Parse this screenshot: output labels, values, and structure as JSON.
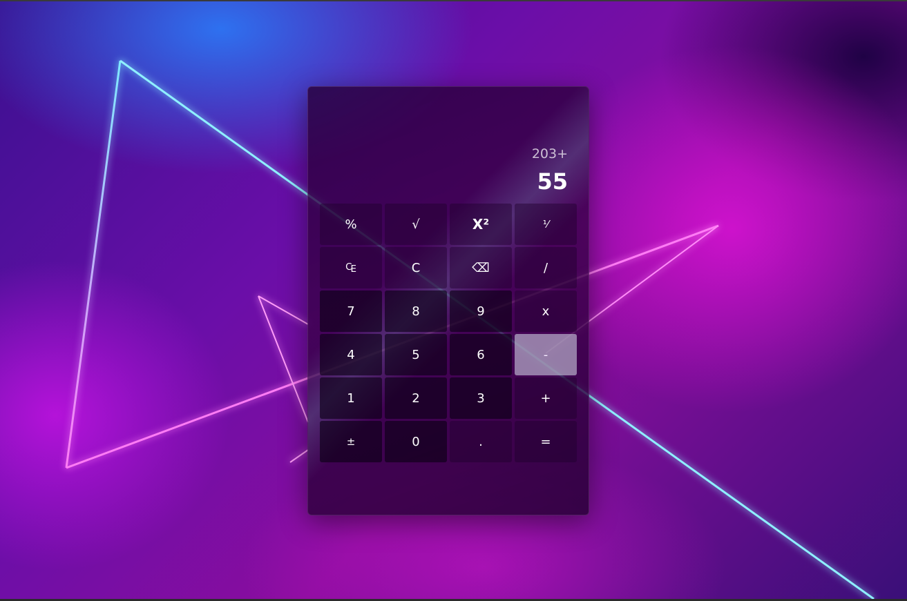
{
  "display": {
    "expression": "203+",
    "result": "55"
  },
  "keys": [
    {
      "label": "%",
      "name": "percent-button"
    },
    {
      "label": "√",
      "name": "square-root-button"
    },
    {
      "label": "X²",
      "name": "square-button"
    },
    {
      "label": "¹⁄",
      "name": "reciprocal-button"
    },
    {
      "label": "₠",
      "name": "clear-entry-button"
    },
    {
      "label": "C",
      "name": "clear-button"
    },
    {
      "label": "⌫",
      "name": "backspace-button"
    },
    {
      "label": "/",
      "name": "divide-button"
    },
    {
      "label": "7",
      "name": "digit-7-button"
    },
    {
      "label": "8",
      "name": "digit-8-button"
    },
    {
      "label": "9",
      "name": "digit-9-button"
    },
    {
      "label": "x",
      "name": "multiply-button"
    },
    {
      "label": "4",
      "name": "digit-4-button"
    },
    {
      "label": "5",
      "name": "digit-5-button"
    },
    {
      "label": "6",
      "name": "digit-6-button"
    },
    {
      "label": "-",
      "name": "subtract-button"
    },
    {
      "label": "1",
      "name": "digit-1-button"
    },
    {
      "label": "2",
      "name": "digit-2-button"
    },
    {
      "label": "3",
      "name": "digit-3-button"
    },
    {
      "label": "+",
      "name": "add-button"
    },
    {
      "label": "±",
      "name": "negate-button"
    },
    {
      "label": "0",
      "name": "digit-0-button"
    },
    {
      "label": ".",
      "name": "decimal-button"
    },
    {
      "label": "=",
      "name": "equals-button"
    }
  ],
  "active_key": "subtract-button",
  "colors": {
    "neon_cyan": "#7fe9ff",
    "neon_magenta": "#ff6cf5",
    "active_key": "#c8c8dc"
  }
}
